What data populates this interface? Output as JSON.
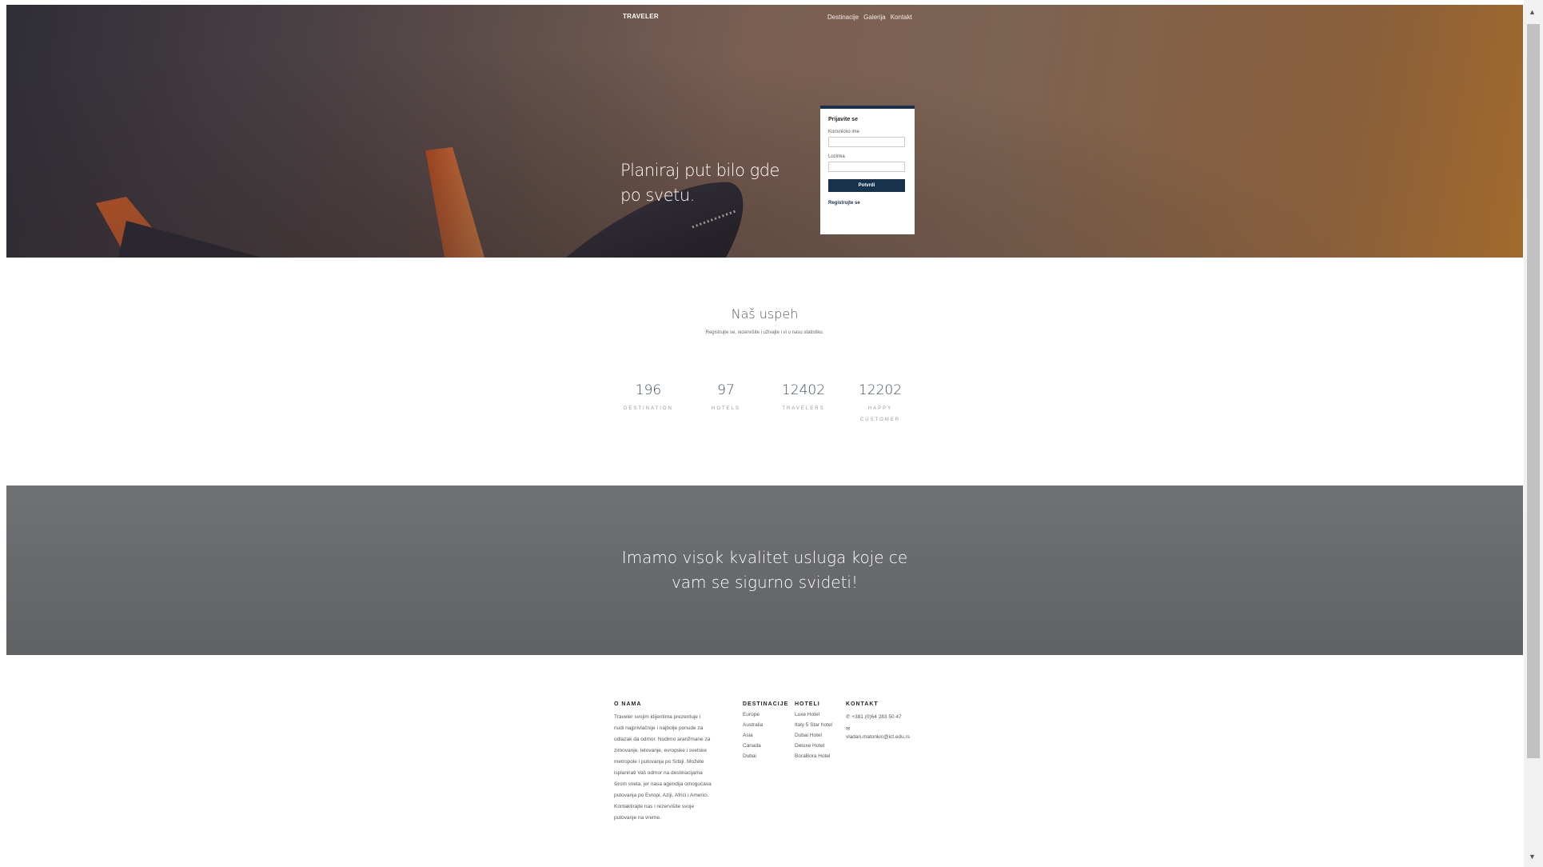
{
  "brand": "TRAVELER",
  "nav": [
    "Destinacije",
    "Galerija",
    "Kontakt"
  ],
  "hero": {
    "title": "Planiraj put bilo gde po svetu."
  },
  "login": {
    "title": "Prijavite se",
    "username_label": "Korisnicko ime",
    "password_label": "Lozinka",
    "submit_label": "Potvrdi",
    "register_link": "Registrujte se"
  },
  "success": {
    "title": "Naš uspeh",
    "subtitle": "Registrujte se, rezervišite i uživajte i vi u nasu statistiku.",
    "stats": [
      {
        "value": "196",
        "label": "DESTINATION"
      },
      {
        "value": "97",
        "label": "HOTELS"
      },
      {
        "value": "12402",
        "label": "TRAVELERS"
      },
      {
        "value": "12202",
        "label": "HAPPY CUSTOMER"
      }
    ]
  },
  "band": {
    "text": "Imamo visok kvalitet usluga koje ce vam se sigurno svideti!"
  },
  "footer": {
    "about": {
      "heading": "O NAMA",
      "text": "Traveler svojim klijentima prezentuje i nudi najprivlačnije i najbolje ponude za odlazak da odmor. Nudimo aranžmane za zimovanje, letovanje, evropske i svetske metropole i putovanja po Srbiji. Možete isplanirati Vaš odmor na destinacijama širom sveta, jer nasa agendija omogućava putovanja po Evropi, Aziji, Africi i Americi. Kontaktirajte nas i rezervišite svoje putovanje na vreme."
    },
    "destinations": {
      "heading": "DESTINACIJE",
      "items": [
        "Europe",
        "Australia",
        "Asia",
        "Canada",
        "Dubai"
      ]
    },
    "hotels": {
      "heading": "HOTELI",
      "items": [
        "Luxe Hotel",
        "Italy 5 Star hotel",
        "Dubai Hotel",
        "Deluxe Hotel",
        "BoraBora Hotel"
      ]
    },
    "contact": {
      "heading": "KONTAKT",
      "phone": "+381 (0)64 283 50 47",
      "email": "vladan.matonkic@ict.edu.rs"
    }
  },
  "theme": {
    "accent": "#17324d",
    "band": "#65676a"
  }
}
